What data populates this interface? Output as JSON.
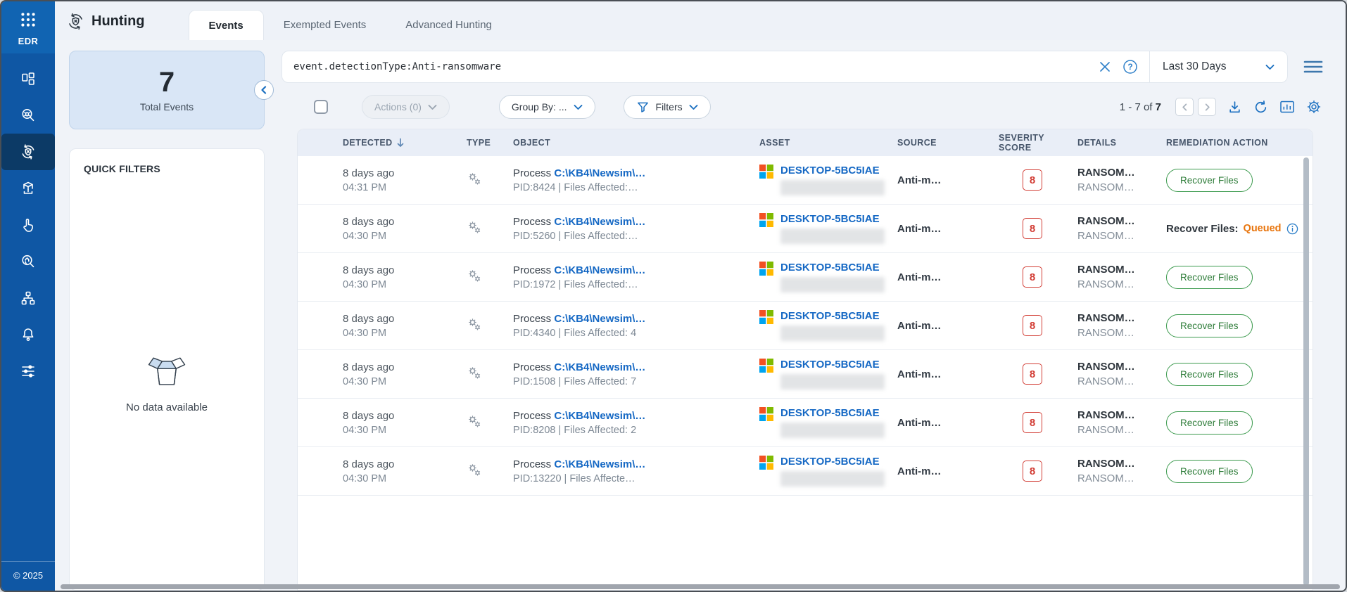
{
  "app": {
    "product": "EDR",
    "copyright": "© 2025"
  },
  "sidebar": {
    "items": [
      {
        "name": "dashboard",
        "active": false
      },
      {
        "name": "threat-search",
        "active": false
      },
      {
        "name": "hunting",
        "active": true
      },
      {
        "name": "assets",
        "active": false
      },
      {
        "name": "response",
        "active": false
      },
      {
        "name": "forensics",
        "active": false
      },
      {
        "name": "topology",
        "active": false
      },
      {
        "name": "notifications",
        "active": false
      },
      {
        "name": "settings",
        "active": false
      }
    ]
  },
  "header": {
    "title": "Hunting",
    "tabs": [
      {
        "label": "Events",
        "active": true
      },
      {
        "label": "Exempted Events",
        "active": false
      },
      {
        "label": "Advanced Hunting",
        "active": false
      }
    ]
  },
  "summary": {
    "total_value": "7",
    "total_label": "Total Events"
  },
  "quick_filters": {
    "title": "QUICK FILTERS",
    "empty_text": "No data available"
  },
  "search": {
    "query": "event.detectionType:Anti-ransomware",
    "time_range": "Last 30 Days"
  },
  "toolbar": {
    "actions": "Actions (0)",
    "group_by": "Group By: ...",
    "filters": "Filters",
    "range": "1 - 7 of",
    "range_total": "7",
    "icon_names": [
      "prev-page",
      "next-page",
      "download",
      "refresh",
      "chart",
      "settings"
    ]
  },
  "table": {
    "columns": [
      "DETECTED",
      "TYPE",
      "OBJECT",
      "ASSET",
      "SOURCE",
      "SEVERITY SCORE",
      "DETAILS",
      "REMEDIATION ACTION"
    ],
    "sort": {
      "column": "DETECTED",
      "direction": "desc"
    },
    "rows": [
      {
        "ago": "8 days ago",
        "time": "04:31 PM",
        "type": "process",
        "object_prefix": "Process",
        "object_link": "C:\\KB4\\Newsim\\…",
        "object_sub": "PID:8424 | Files Affected:…",
        "asset": "DESKTOP-5BC5IAE",
        "source": "Anti-m…",
        "severity": "8",
        "details": "RANSOM…",
        "details_sub": "RANSOM…",
        "remediation": {
          "type": "button",
          "label": "Recover Files"
        }
      },
      {
        "ago": "8 days ago",
        "time": "04:30 PM",
        "type": "process",
        "object_prefix": "Process",
        "object_link": "C:\\KB4\\Newsim\\…",
        "object_sub": "PID:5260 | Files Affected:…",
        "asset": "DESKTOP-5BC5IAE",
        "source": "Anti-m…",
        "severity": "8",
        "details": "RANSOM…",
        "details_sub": "RANSOM…",
        "remediation": {
          "type": "status",
          "label": "Recover Files:",
          "status": "Queued"
        }
      },
      {
        "ago": "8 days ago",
        "time": "04:30 PM",
        "type": "process",
        "object_prefix": "Process",
        "object_link": "C:\\KB4\\Newsim\\…",
        "object_sub": "PID:1972 | Files Affected:…",
        "asset": "DESKTOP-5BC5IAE",
        "source": "Anti-m…",
        "severity": "8",
        "details": "RANSOM…",
        "details_sub": "RANSOM…",
        "remediation": {
          "type": "button",
          "label": "Recover Files"
        }
      },
      {
        "ago": "8 days ago",
        "time": "04:30 PM",
        "type": "process",
        "object_prefix": "Process",
        "object_link": "C:\\KB4\\Newsim\\…",
        "object_sub": "PID:4340 | Files Affected: 4",
        "asset": "DESKTOP-5BC5IAE",
        "source": "Anti-m…",
        "severity": "8",
        "details": "RANSOM…",
        "details_sub": "RANSOM…",
        "remediation": {
          "type": "button",
          "label": "Recover Files"
        }
      },
      {
        "ago": "8 days ago",
        "time": "04:30 PM",
        "type": "process",
        "object_prefix": "Process",
        "object_link": "C:\\KB4\\Newsim\\…",
        "object_sub": "PID:1508 | Files Affected: 7",
        "asset": "DESKTOP-5BC5IAE",
        "source": "Anti-m…",
        "severity": "8",
        "details": "RANSOM…",
        "details_sub": "RANSOM…",
        "remediation": {
          "type": "button",
          "label": "Recover Files"
        }
      },
      {
        "ago": "8 days ago",
        "time": "04:30 PM",
        "type": "process",
        "object_prefix": "Process",
        "object_link": "C:\\KB4\\Newsim\\…",
        "object_sub": "PID:8208 | Files Affected: 2",
        "asset": "DESKTOP-5BC5IAE",
        "source": "Anti-m…",
        "severity": "8",
        "details": "RANSOM…",
        "details_sub": "RANSOM…",
        "remediation": {
          "type": "button",
          "label": "Recover Files"
        }
      },
      {
        "ago": "8 days ago",
        "time": "04:30 PM",
        "type": "process",
        "object_prefix": "Process",
        "object_link": "C:\\KB4\\Newsim\\…",
        "object_sub": "PID:13220 | Files Affecte…",
        "asset": "DESKTOP-5BC5IAE",
        "source": "Anti-m…",
        "severity": "8",
        "details": "RANSOM…",
        "details_sub": "RANSOM…",
        "remediation": {
          "type": "button",
          "label": "Recover Files"
        }
      }
    ]
  }
}
